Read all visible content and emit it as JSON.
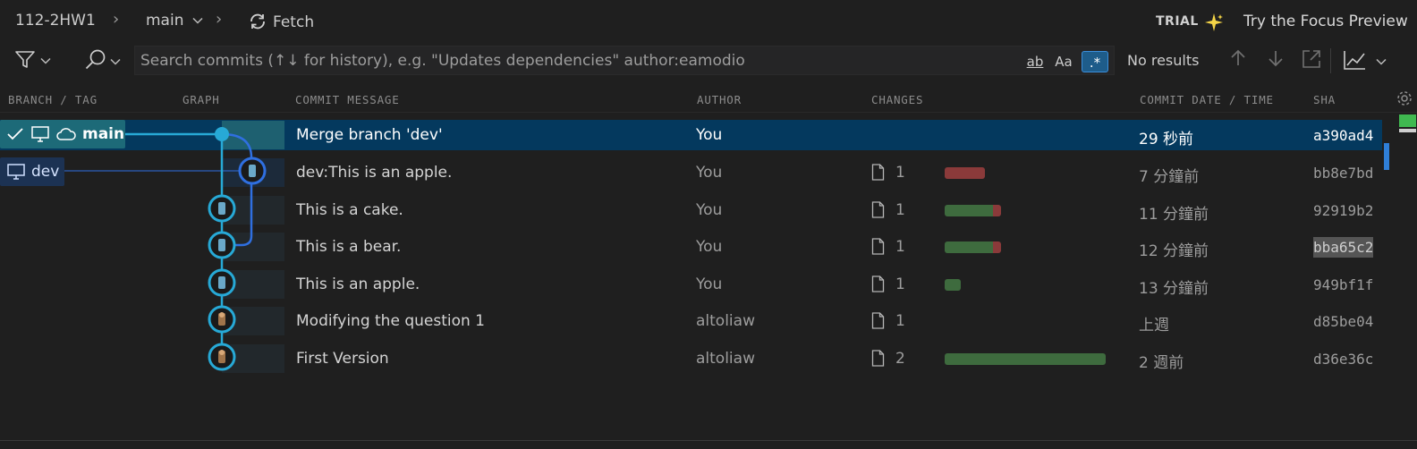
{
  "topbar": {
    "repo": "112-2HW1",
    "branch": "main",
    "fetch_label": "Fetch",
    "trial_label": "TRIAL",
    "focus_label": "Try the Focus Preview"
  },
  "search": {
    "placeholder": "Search commits (↑↓ for history), e.g. \"Updates dependencies\" author:eamodio",
    "match_word_label": "ab",
    "match_case_label": "Aa",
    "regex_label": ".*",
    "results_label": "No results"
  },
  "columns": {
    "branch": "BRANCH / TAG",
    "graph": "GRAPH",
    "message": "COMMIT MESSAGE",
    "author": "AUTHOR",
    "changes": "CHANGES",
    "date": "COMMIT DATE / TIME",
    "sha": "SHA"
  },
  "branches": {
    "main": "main",
    "dev": "dev"
  },
  "commits": [
    {
      "message": "Merge branch 'dev'",
      "author": "You",
      "files": "",
      "date": "29 秒前",
      "sha": "a390ad4",
      "adds": 0,
      "dels": 0
    },
    {
      "message": "dev:This is an apple.",
      "author": "You",
      "files": "1",
      "date": "7 分鐘前",
      "sha": "bb8e7bd",
      "adds": 0,
      "dels": 1
    },
    {
      "message": "This is a cake.",
      "author": "You",
      "files": "1",
      "date": "11 分鐘前",
      "sha": "92919b2",
      "adds": 6,
      "dels": 1
    },
    {
      "message": "This is a bear.",
      "author": "You",
      "files": "1",
      "date": "12 分鐘前",
      "sha": "bba65c2",
      "adds": 6,
      "dels": 1
    },
    {
      "message": "This is an apple.",
      "author": "You",
      "files": "1",
      "date": "13 分鐘前",
      "sha": "949bf1f",
      "adds": 2,
      "dels": 0
    },
    {
      "message": "Modifying the question 1",
      "author": "altoliaw",
      "files": "1",
      "date": "上週",
      "sha": "d85be04",
      "adds": 0,
      "dels": 0
    },
    {
      "message": "First Version",
      "author": "altoliaw",
      "files": "2",
      "date": "2 週前",
      "sha": "d36e36c",
      "adds": 20,
      "dels": 0
    }
  ],
  "colors": {
    "main_branch": "#1d6a78",
    "dev_branch": "#2f6fe0",
    "graph_main": "#27a9d6",
    "additions": "#3e6b3e",
    "deletions": "#8a3a3a",
    "selected_row": "#04395e"
  }
}
